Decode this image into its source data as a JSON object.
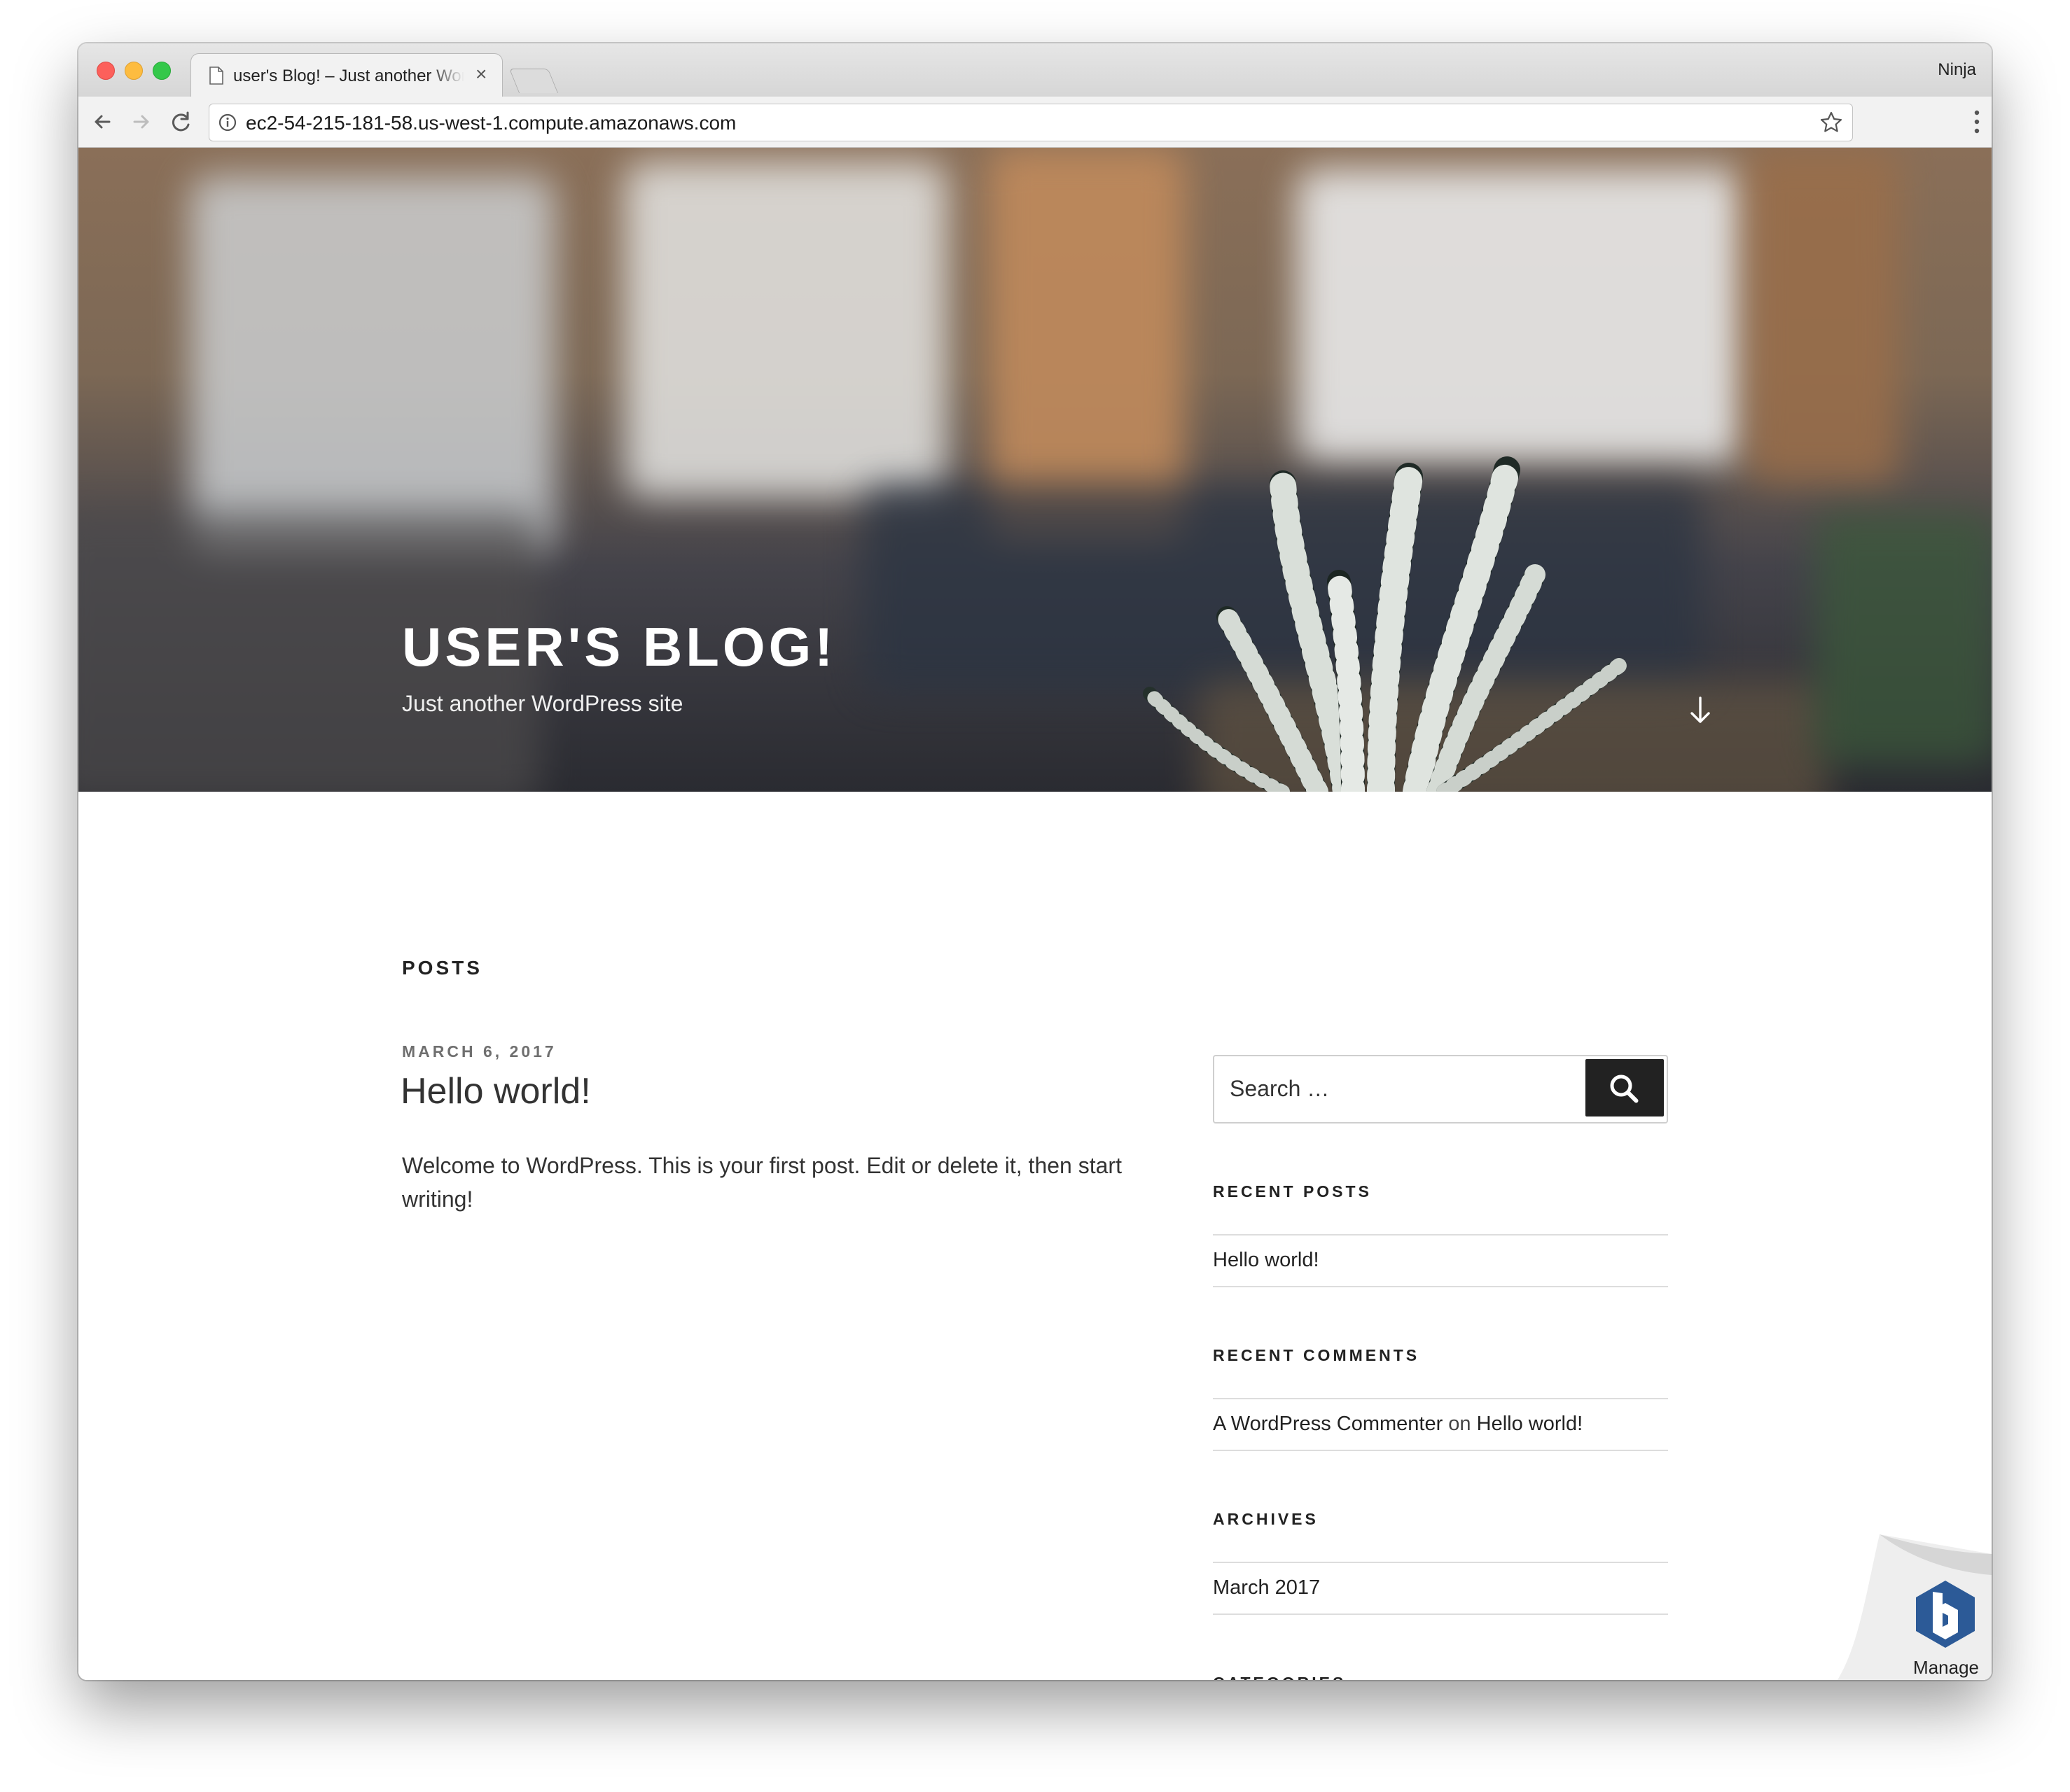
{
  "browser": {
    "tab_title": "user's Blog! – Just another WordPress site",
    "tab_close": "×",
    "profile_name": "Ninja",
    "url": "ec2-54-215-181-58.us-west-1.compute.amazonaws.com",
    "icons": {
      "back": "back-arrow-icon",
      "forward": "forward-arrow-icon",
      "reload": "reload-icon",
      "info": "info-icon",
      "bookmark": "star-icon",
      "menu": "vertical-dots-menu-icon",
      "tab_page": "document-icon"
    }
  },
  "header": {
    "site_title": "USER'S BLOG!",
    "tagline": "Just another WordPress site",
    "scroll_icon": "down-arrow-icon"
  },
  "main": {
    "section_title": "POSTS",
    "posts": [
      {
        "date": "MARCH 6, 2017",
        "title": "Hello world!",
        "excerpt": "Welcome to WordPress. This is your first post. Edit or delete it, then start writing!"
      }
    ]
  },
  "sidebar": {
    "search": {
      "placeholder": "Search …",
      "button_icon": "search-icon"
    },
    "widgets": {
      "recent_posts": {
        "title": "RECENT POSTS",
        "items": [
          "Hello world!"
        ]
      },
      "recent_comments": {
        "title": "RECENT COMMENTS",
        "author": "A WordPress Commenter",
        "connector": "on",
        "post": "Hello world!"
      },
      "archives": {
        "title": "ARCHIVES",
        "items": [
          "March 2017"
        ]
      },
      "categories": {
        "title": "CATEGORIES"
      }
    }
  },
  "manage_badge": {
    "label": "Manage",
    "icon": "bitnami-hexagon-icon"
  },
  "colors": {
    "accent_dark": "#222222",
    "traffic_red": "#fc605b",
    "traffic_yellow": "#fdbc40",
    "traffic_green": "#34c84a",
    "bitnami_blue": "#2c5a97"
  }
}
